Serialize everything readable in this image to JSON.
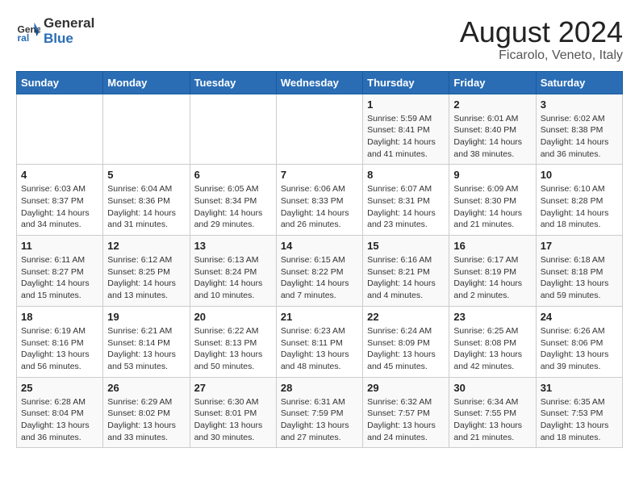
{
  "logo": {
    "line1": "General",
    "line2": "Blue"
  },
  "title": "August 2024",
  "subtitle": "Ficarolo, Veneto, Italy",
  "days_of_week": [
    "Sunday",
    "Monday",
    "Tuesday",
    "Wednesday",
    "Thursday",
    "Friday",
    "Saturday"
  ],
  "weeks": [
    [
      {
        "day": "",
        "info": ""
      },
      {
        "day": "",
        "info": ""
      },
      {
        "day": "",
        "info": ""
      },
      {
        "day": "",
        "info": ""
      },
      {
        "day": "1",
        "info": "Sunrise: 5:59 AM\nSunset: 8:41 PM\nDaylight: 14 hours and 41 minutes."
      },
      {
        "day": "2",
        "info": "Sunrise: 6:01 AM\nSunset: 8:40 PM\nDaylight: 14 hours and 38 minutes."
      },
      {
        "day": "3",
        "info": "Sunrise: 6:02 AM\nSunset: 8:38 PM\nDaylight: 14 hours and 36 minutes."
      }
    ],
    [
      {
        "day": "4",
        "info": "Sunrise: 6:03 AM\nSunset: 8:37 PM\nDaylight: 14 hours and 34 minutes."
      },
      {
        "day": "5",
        "info": "Sunrise: 6:04 AM\nSunset: 8:36 PM\nDaylight: 14 hours and 31 minutes."
      },
      {
        "day": "6",
        "info": "Sunrise: 6:05 AM\nSunset: 8:34 PM\nDaylight: 14 hours and 29 minutes."
      },
      {
        "day": "7",
        "info": "Sunrise: 6:06 AM\nSunset: 8:33 PM\nDaylight: 14 hours and 26 minutes."
      },
      {
        "day": "8",
        "info": "Sunrise: 6:07 AM\nSunset: 8:31 PM\nDaylight: 14 hours and 23 minutes."
      },
      {
        "day": "9",
        "info": "Sunrise: 6:09 AM\nSunset: 8:30 PM\nDaylight: 14 hours and 21 minutes."
      },
      {
        "day": "10",
        "info": "Sunrise: 6:10 AM\nSunset: 8:28 PM\nDaylight: 14 hours and 18 minutes."
      }
    ],
    [
      {
        "day": "11",
        "info": "Sunrise: 6:11 AM\nSunset: 8:27 PM\nDaylight: 14 hours and 15 minutes."
      },
      {
        "day": "12",
        "info": "Sunrise: 6:12 AM\nSunset: 8:25 PM\nDaylight: 14 hours and 13 minutes."
      },
      {
        "day": "13",
        "info": "Sunrise: 6:13 AM\nSunset: 8:24 PM\nDaylight: 14 hours and 10 minutes."
      },
      {
        "day": "14",
        "info": "Sunrise: 6:15 AM\nSunset: 8:22 PM\nDaylight: 14 hours and 7 minutes."
      },
      {
        "day": "15",
        "info": "Sunrise: 6:16 AM\nSunset: 8:21 PM\nDaylight: 14 hours and 4 minutes."
      },
      {
        "day": "16",
        "info": "Sunrise: 6:17 AM\nSunset: 8:19 PM\nDaylight: 14 hours and 2 minutes."
      },
      {
        "day": "17",
        "info": "Sunrise: 6:18 AM\nSunset: 8:18 PM\nDaylight: 13 hours and 59 minutes."
      }
    ],
    [
      {
        "day": "18",
        "info": "Sunrise: 6:19 AM\nSunset: 8:16 PM\nDaylight: 13 hours and 56 minutes."
      },
      {
        "day": "19",
        "info": "Sunrise: 6:21 AM\nSunset: 8:14 PM\nDaylight: 13 hours and 53 minutes."
      },
      {
        "day": "20",
        "info": "Sunrise: 6:22 AM\nSunset: 8:13 PM\nDaylight: 13 hours and 50 minutes."
      },
      {
        "day": "21",
        "info": "Sunrise: 6:23 AM\nSunset: 8:11 PM\nDaylight: 13 hours and 48 minutes."
      },
      {
        "day": "22",
        "info": "Sunrise: 6:24 AM\nSunset: 8:09 PM\nDaylight: 13 hours and 45 minutes."
      },
      {
        "day": "23",
        "info": "Sunrise: 6:25 AM\nSunset: 8:08 PM\nDaylight: 13 hours and 42 minutes."
      },
      {
        "day": "24",
        "info": "Sunrise: 6:26 AM\nSunset: 8:06 PM\nDaylight: 13 hours and 39 minutes."
      }
    ],
    [
      {
        "day": "25",
        "info": "Sunrise: 6:28 AM\nSunset: 8:04 PM\nDaylight: 13 hours and 36 minutes."
      },
      {
        "day": "26",
        "info": "Sunrise: 6:29 AM\nSunset: 8:02 PM\nDaylight: 13 hours and 33 minutes."
      },
      {
        "day": "27",
        "info": "Sunrise: 6:30 AM\nSunset: 8:01 PM\nDaylight: 13 hours and 30 minutes."
      },
      {
        "day": "28",
        "info": "Sunrise: 6:31 AM\nSunset: 7:59 PM\nDaylight: 13 hours and 27 minutes."
      },
      {
        "day": "29",
        "info": "Sunrise: 6:32 AM\nSunset: 7:57 PM\nDaylight: 13 hours and 24 minutes."
      },
      {
        "day": "30",
        "info": "Sunrise: 6:34 AM\nSunset: 7:55 PM\nDaylight: 13 hours and 21 minutes."
      },
      {
        "day": "31",
        "info": "Sunrise: 6:35 AM\nSunset: 7:53 PM\nDaylight: 13 hours and 18 minutes."
      }
    ]
  ]
}
